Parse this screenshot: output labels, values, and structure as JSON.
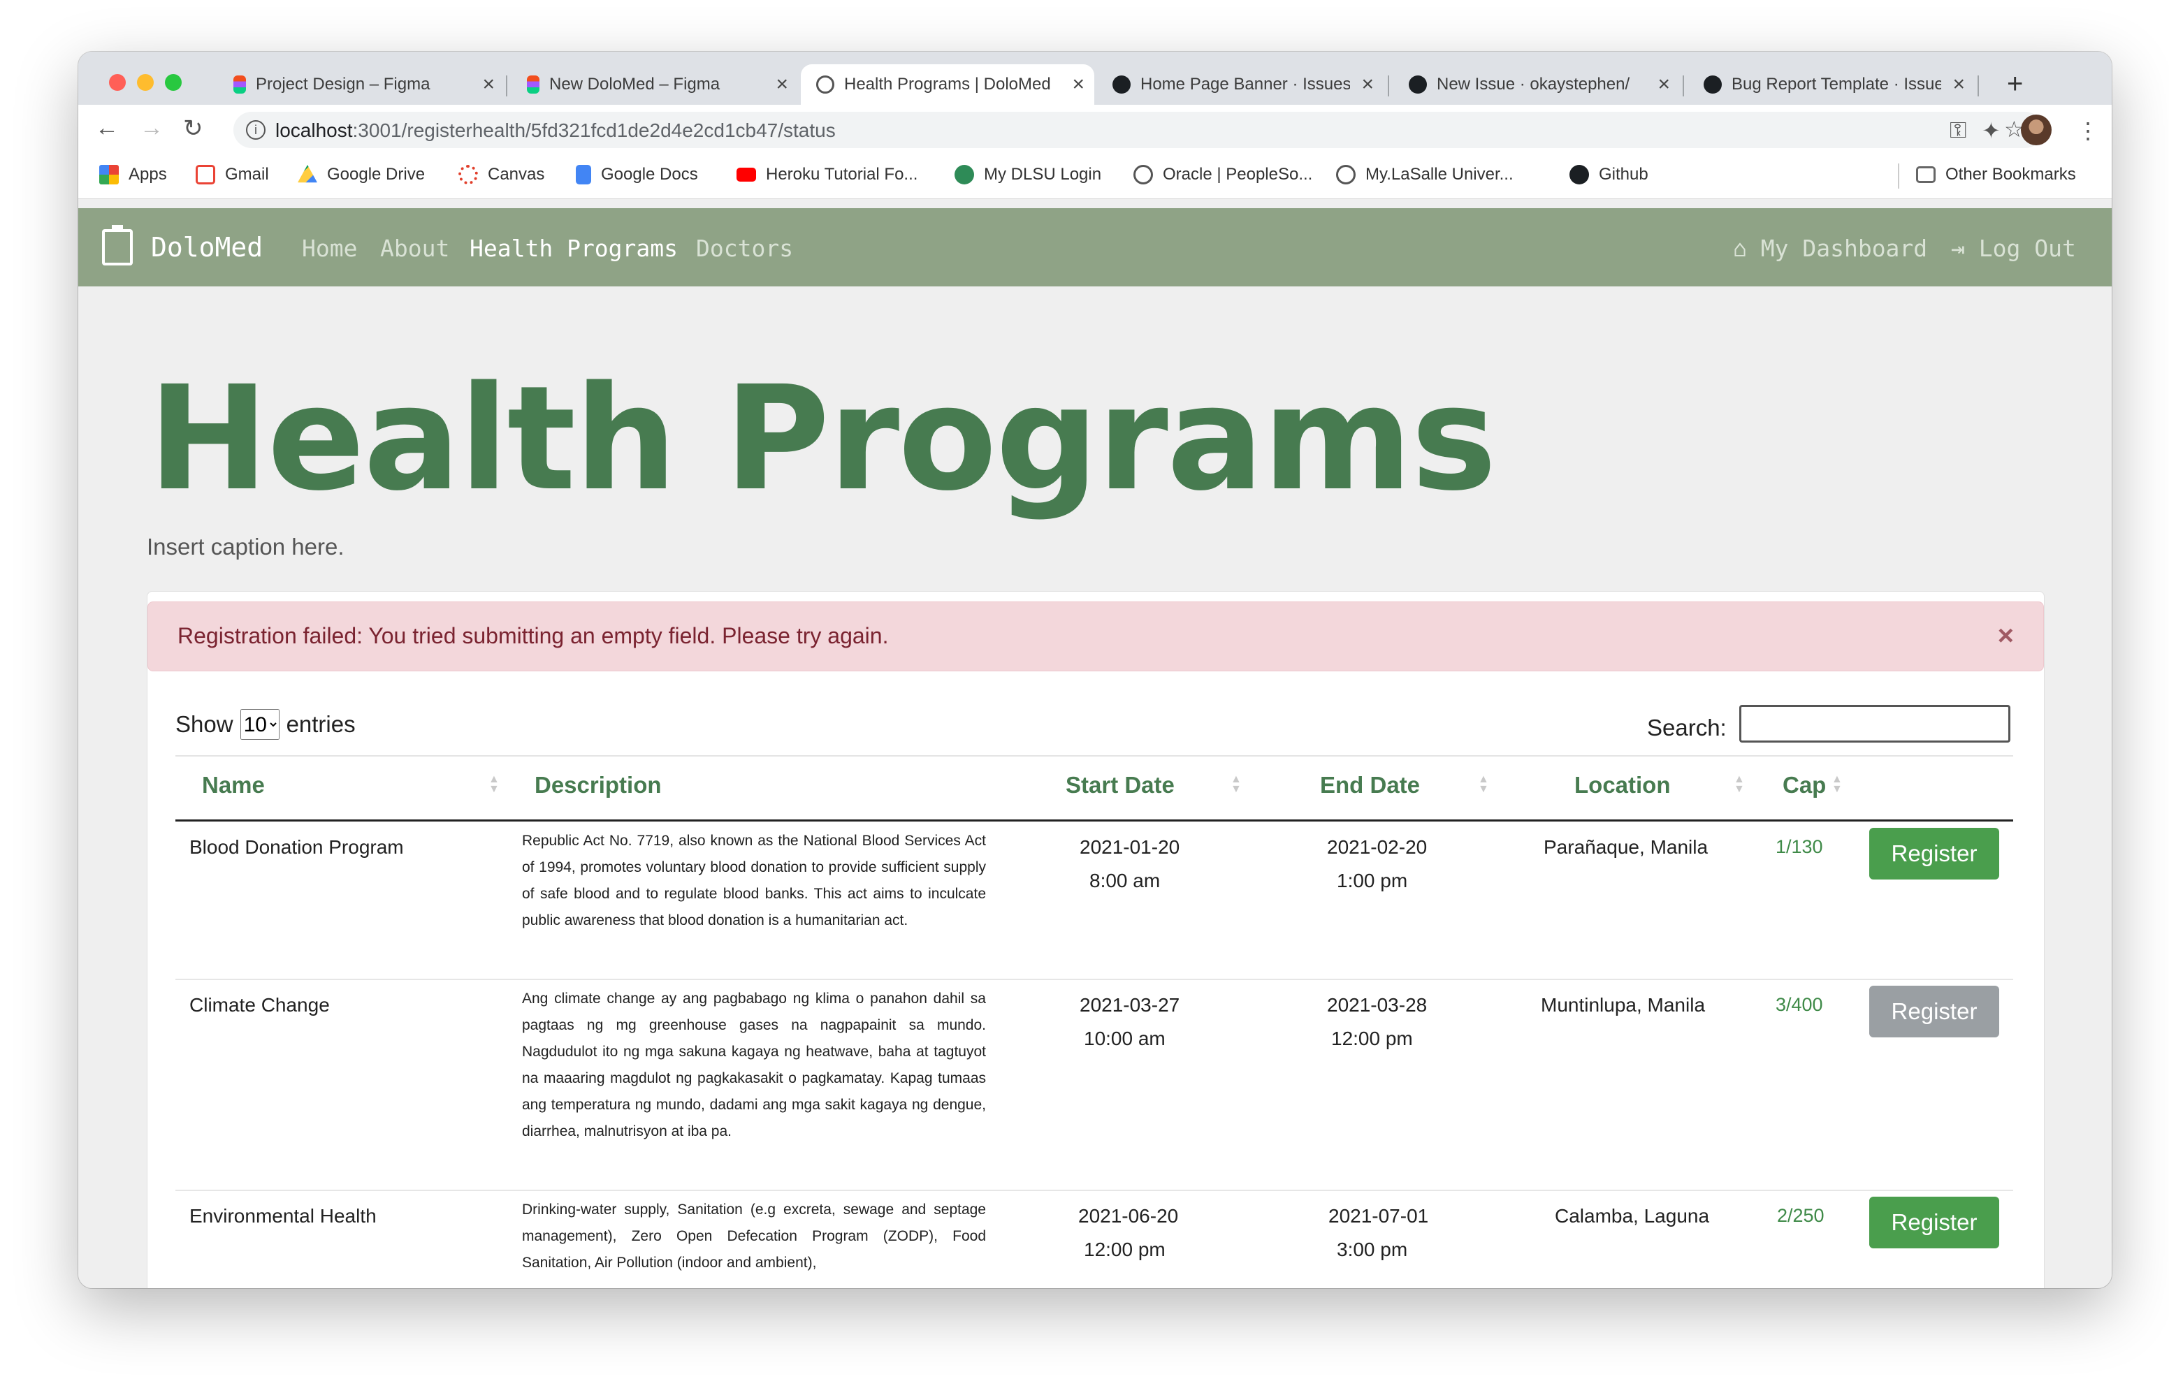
{
  "browser": {
    "tabs": [
      {
        "title": "Project Design – Figma",
        "icon": "figma-icon"
      },
      {
        "title": "New DoloMed – Figma",
        "icon": "figma-icon"
      },
      {
        "title": "Health Programs | DoloMed",
        "icon": "globe-icon"
      },
      {
        "title": "Home Page Banner · Issues",
        "icon": "github-icon"
      },
      {
        "title": "New Issue · okaystephen/",
        "icon": "github-icon"
      },
      {
        "title": "Bug Report Template · Issues",
        "icon": "github-icon"
      }
    ],
    "url_host": "localhost",
    "url_path": ":3001/registerhealth/5fd321fcd1de2d4e2cd1cb47/status",
    "bookmarks": [
      {
        "label": "Apps"
      },
      {
        "label": "Gmail"
      },
      {
        "label": "Google Drive"
      },
      {
        "label": "Canvas"
      },
      {
        "label": "Google Docs"
      },
      {
        "label": "Heroku Tutorial Fo..."
      },
      {
        "label": "My DLSU Login"
      },
      {
        "label": "Oracle | PeopleSo..."
      },
      {
        "label": "My.LaSalle Univer..."
      },
      {
        "label": "Github"
      }
    ],
    "other_bookmarks": "Other Bookmarks"
  },
  "site": {
    "brand": "DoloMed",
    "nav": {
      "home": "Home",
      "about": "About",
      "programs": "Health Programs",
      "doctors": "Doctors"
    },
    "dashboard": "My Dashboard",
    "logout": "Log Out",
    "colors": {
      "navbar": "#8fa386",
      "accent": "#477b50",
      "alert_bg": "#f3d7db"
    }
  },
  "page": {
    "title": "Health Programs",
    "caption": "Insert caption here.",
    "alert": "Registration failed: You tried submitting an empty field. Please try again.",
    "alert_close": "×",
    "show_label": "Show",
    "entries_value": "10",
    "entries_label": "entries",
    "search_label": "Search:"
  },
  "table": {
    "headers": {
      "name": "Name",
      "description": "Description",
      "start": "Start Date",
      "end": "End Date",
      "location": "Location",
      "cap": "Cap"
    },
    "rows": [
      {
        "name": "Blood Donation Program",
        "description": "Republic Act No. 7719, also known as the National Blood Services Act of 1994, promotes voluntary blood donation to provide sufficient supply of safe blood and to regulate blood banks. This act aims to inculcate public awareness that blood donation is a humanitarian act.",
        "start_date": "2021-01-20",
        "start_time": "8:00 am",
        "end_date": "2021-02-20",
        "end_time": "1:00 pm",
        "location": "Parañaque, Manila",
        "cap": "1/130",
        "action": "Register"
      },
      {
        "name": "Climate Change",
        "description": "Ang climate change ay ang pagbabago ng klima o panahon dahil sa pagtaas ng mg greenhouse gases na nagpapainit sa mundo. Nagdudulot ito ng mga sakuna kagaya ng heatwave, baha at tagtuyot na maaaring magdulot ng pagkakasakit o pagkamatay. Kapag tumaas ang temperatura ng mundo, dadami ang mga sakit kagaya ng dengue, diarrhea, malnutrisyon at iba pa.",
        "start_date": "2021-03-27",
        "start_time": "10:00 am",
        "end_date": "2021-03-28",
        "end_time": "12:00 pm",
        "location": "Muntinlupa, Manila",
        "cap": "3/400",
        "action": "Register"
      },
      {
        "name": "Environmental Health",
        "description": "Drinking-water supply, Sanitation (e.g excreta, sewage and septage management), Zero Open Defecation Program (ZODP), Food Sanitation, Air Pollution (indoor and ambient),",
        "start_date": "2021-06-20",
        "start_time": "12:00 pm",
        "end_date": "2021-07-01",
        "end_time": "3:00 pm",
        "location": "Calamba, Laguna",
        "cap": "2/250",
        "action": "Register"
      }
    ]
  }
}
